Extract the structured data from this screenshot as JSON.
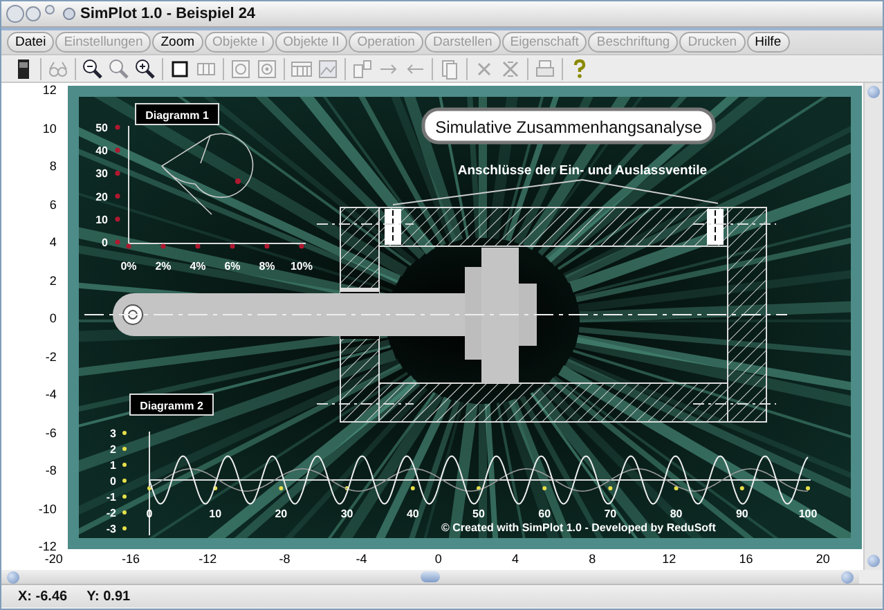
{
  "window": {
    "title": "SimPlot 1.0 - Beispiel 24"
  },
  "menu_tabs": [
    {
      "label": "Datei",
      "disabled": false
    },
    {
      "label": "Einstellungen",
      "disabled": true
    },
    {
      "label": "Zoom",
      "disabled": false
    },
    {
      "label": "Objekte I",
      "disabled": true
    },
    {
      "label": "Objekte II",
      "disabled": true
    },
    {
      "label": "Operation",
      "disabled": true
    },
    {
      "label": "Darstellen",
      "disabled": true
    },
    {
      "label": "Eigenschaft",
      "disabled": true
    },
    {
      "label": "Beschriftung",
      "disabled": true
    },
    {
      "label": "Drucken",
      "disabled": true
    },
    {
      "label": "Hilfe",
      "disabled": false
    }
  ],
  "toolbar": {
    "groups": [
      [
        {
          "kind": "device",
          "disabled": false
        }
      ],
      [
        {
          "kind": "glasses",
          "disabled": true
        }
      ],
      [
        {
          "kind": "zoom-out",
          "disabled": false
        },
        {
          "kind": "zoom",
          "disabled": true
        },
        {
          "kind": "zoom-in",
          "disabled": false
        }
      ],
      [
        {
          "kind": "square",
          "disabled": false
        },
        {
          "kind": "columns",
          "disabled": true
        }
      ],
      [
        {
          "kind": "circle",
          "disabled": true
        },
        {
          "kind": "circle-dot",
          "disabled": true
        }
      ],
      [
        {
          "kind": "table",
          "disabled": true
        },
        {
          "kind": "image",
          "disabled": true
        }
      ],
      [
        {
          "kind": "layout",
          "disabled": true
        },
        {
          "kind": "arrow-right",
          "disabled": true
        },
        {
          "kind": "arrow-left",
          "disabled": true
        }
      ],
      [
        {
          "kind": "pages",
          "disabled": true
        }
      ],
      [
        {
          "kind": "cross",
          "disabled": true
        },
        {
          "kind": "cross-box",
          "disabled": true
        }
      ],
      [
        {
          "kind": "printer",
          "disabled": true
        }
      ],
      [
        {
          "kind": "help",
          "disabled": false
        }
      ]
    ]
  },
  "plot": {
    "y_ticks": [
      "12",
      "10",
      "8",
      "6",
      "4",
      "2",
      "0",
      "-2",
      "-4",
      "-6",
      "-8",
      "-10",
      "-12"
    ],
    "x_ticks": [
      "-20",
      "-16",
      "-12",
      "-8",
      "-4",
      "0",
      "4",
      "8",
      "12",
      "16",
      "20"
    ],
    "graphic": {
      "diagram_1": {
        "label": "Diagramm 1",
        "y_ticks": [
          "50",
          "40",
          "30",
          "20",
          "10",
          "0"
        ],
        "x_ticks": [
          "0%",
          "2%",
          "4%",
          "6%",
          "8%",
          "10%"
        ]
      },
      "title": "Simulative Zusammenhangsanalyse",
      "subtitle": "Anschlüsse der Ein- und Auslassventile",
      "diagram_2": {
        "label": "Diagramm 2",
        "y_ticks": [
          "3",
          "2",
          "1",
          "0",
          "-1",
          "-2",
          "-3"
        ],
        "x_ticks": [
          "0",
          "10",
          "20",
          "30",
          "40",
          "50",
          "60",
          "70",
          "80",
          "90",
          "100"
        ]
      },
      "credit": "© Created with SimPlot 1.0 - Developed by ReduSoft"
    }
  },
  "status_bar": {
    "x": "X: -6.46",
    "y": "Y: 0.91"
  }
}
